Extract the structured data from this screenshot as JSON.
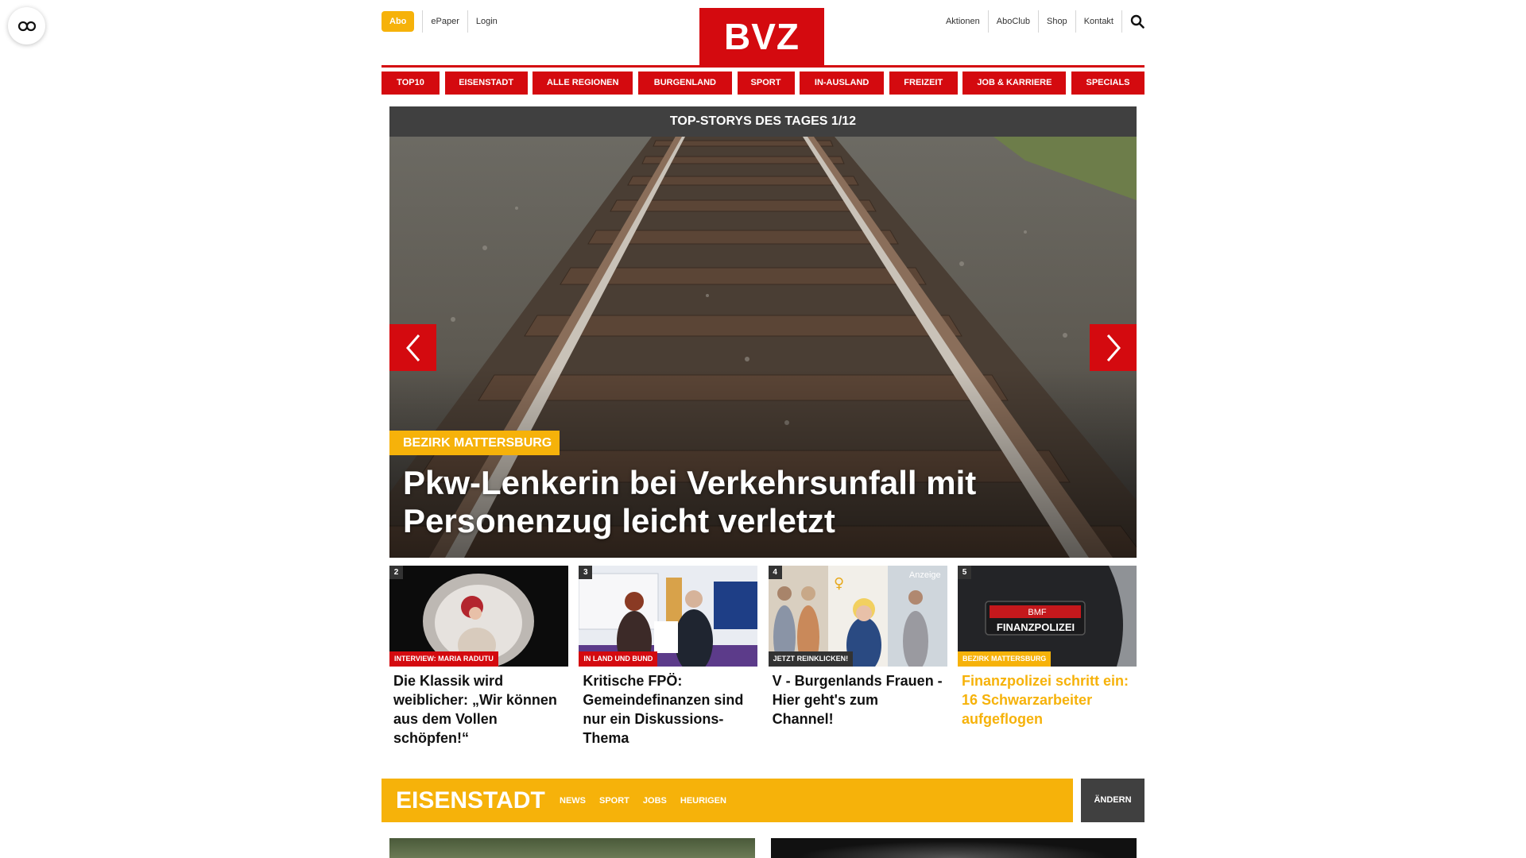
{
  "header": {
    "abo_label": "Abo",
    "left_links": [
      "ePaper",
      "Login"
    ],
    "logo_text": "BVZ",
    "right_links": [
      "Aktionen",
      "AboClub",
      "Shop",
      "Kontakt"
    ]
  },
  "nav": {
    "items": [
      "TOP10",
      "EISENSTADT",
      "ALLE REGIONEN",
      "BURGENLAND",
      "SPORT",
      "IN-AUSLAND",
      "FREIZEIT",
      "JOB & KARRIERE",
      "SPECIALS"
    ]
  },
  "hero": {
    "bar_title": "TOP-STORYS DES TAGES 1/12",
    "category": "BEZIRK MATTERSBURG",
    "title": "Pkw-Lenkerin bei Verkehrsunfall mit Personenzug leicht verletzt"
  },
  "teasers": [
    {
      "num": "2",
      "category": "INTERVIEW: MARIA RADUTU",
      "category_color": "#d40a0f",
      "title": "Die Klassik wird weiblicher: „Wir können aus dem Vollen schöpfen!“",
      "title_color": "dark"
    },
    {
      "num": "3",
      "category": "IN LAND UND BUND",
      "category_color": "#d40a0f",
      "title": "Kritische FPÖ: Gemeindefinanzen sind nur ein Diskussions-Thema",
      "title_color": "dark"
    },
    {
      "num": "4",
      "category": "JETZT REINKLICKEN!",
      "category_color": "#333333",
      "ad_label": "Anzeige",
      "title": "V - Burgenlands Frauen - Hier geht's zum Channel!",
      "title_color": "dark"
    },
    {
      "num": "5",
      "category": "BEZIRK MATTERSBURG",
      "category_color": "#f6b20a",
      "title": "Finanzpolizei schritt ein: 16 Schwarzarbeiter aufgeflogen",
      "title_color": "yellow"
    }
  ],
  "teaser_image_text": {
    "finanzpolizei_patch_top": "BMF",
    "finanzpolizei_patch_bottom": "FINANZPOLIZEI"
  },
  "region": {
    "title": "EISENSTADT",
    "links": [
      "NEWS",
      "SPORT",
      "JOBS",
      "HEURIGEN"
    ],
    "change_label": "ÄNDERN"
  },
  "colors": {
    "brand_red": "#d40a0f",
    "accent_yellow": "#f6b20a",
    "dark_bar": "#404040"
  }
}
